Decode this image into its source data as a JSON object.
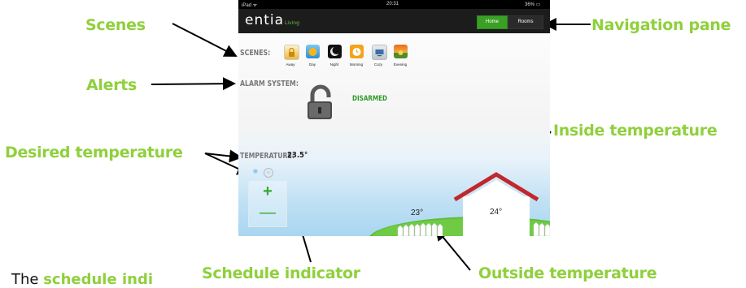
{
  "annotations": {
    "scenes": "Scenes",
    "navigation": "Navigation pane",
    "alerts": "Alerts",
    "inside_temp": "Inside temperature",
    "desired_temp": "Desired temperature",
    "schedule": "Schedule indicator",
    "outside_temp": "Outside temperature"
  },
  "caption": {
    "prefix": "The ",
    "highlight": "schedule indi"
  },
  "device": {
    "status_left": "iPad ᯤ",
    "status_time": "20:31",
    "status_right": "36% ▭"
  },
  "app": {
    "logo": "entia",
    "logo_sub": "Living",
    "nav": {
      "home": "Home",
      "rooms": "Rooms"
    },
    "scenes_label": "SCENES:",
    "scenes": [
      {
        "name": "Away",
        "icon": "lock-icon",
        "color": "#f0b838"
      },
      {
        "name": "Day",
        "icon": "sun-icon",
        "color": "#f4b31b"
      },
      {
        "name": "Night",
        "icon": "moon-icon",
        "color": "#111111"
      },
      {
        "name": "Morning",
        "icon": "alarm-clock-icon",
        "color": "#f6a21d"
      },
      {
        "name": "Cozy",
        "icon": "tv-icon",
        "color": "#cfd8e0"
      },
      {
        "name": "Evening",
        "icon": "sunset-icon",
        "color": "#e96b1e"
      }
    ],
    "alarm_label": "ALARM SYSTEM:",
    "alarm_status": "DISARMED",
    "temp_label": "TEMPERATURE:",
    "temp_value": "23.5°",
    "control_plus": "+",
    "control_minus": "—",
    "outside_temp": "23°",
    "inside_temp": "24°"
  }
}
